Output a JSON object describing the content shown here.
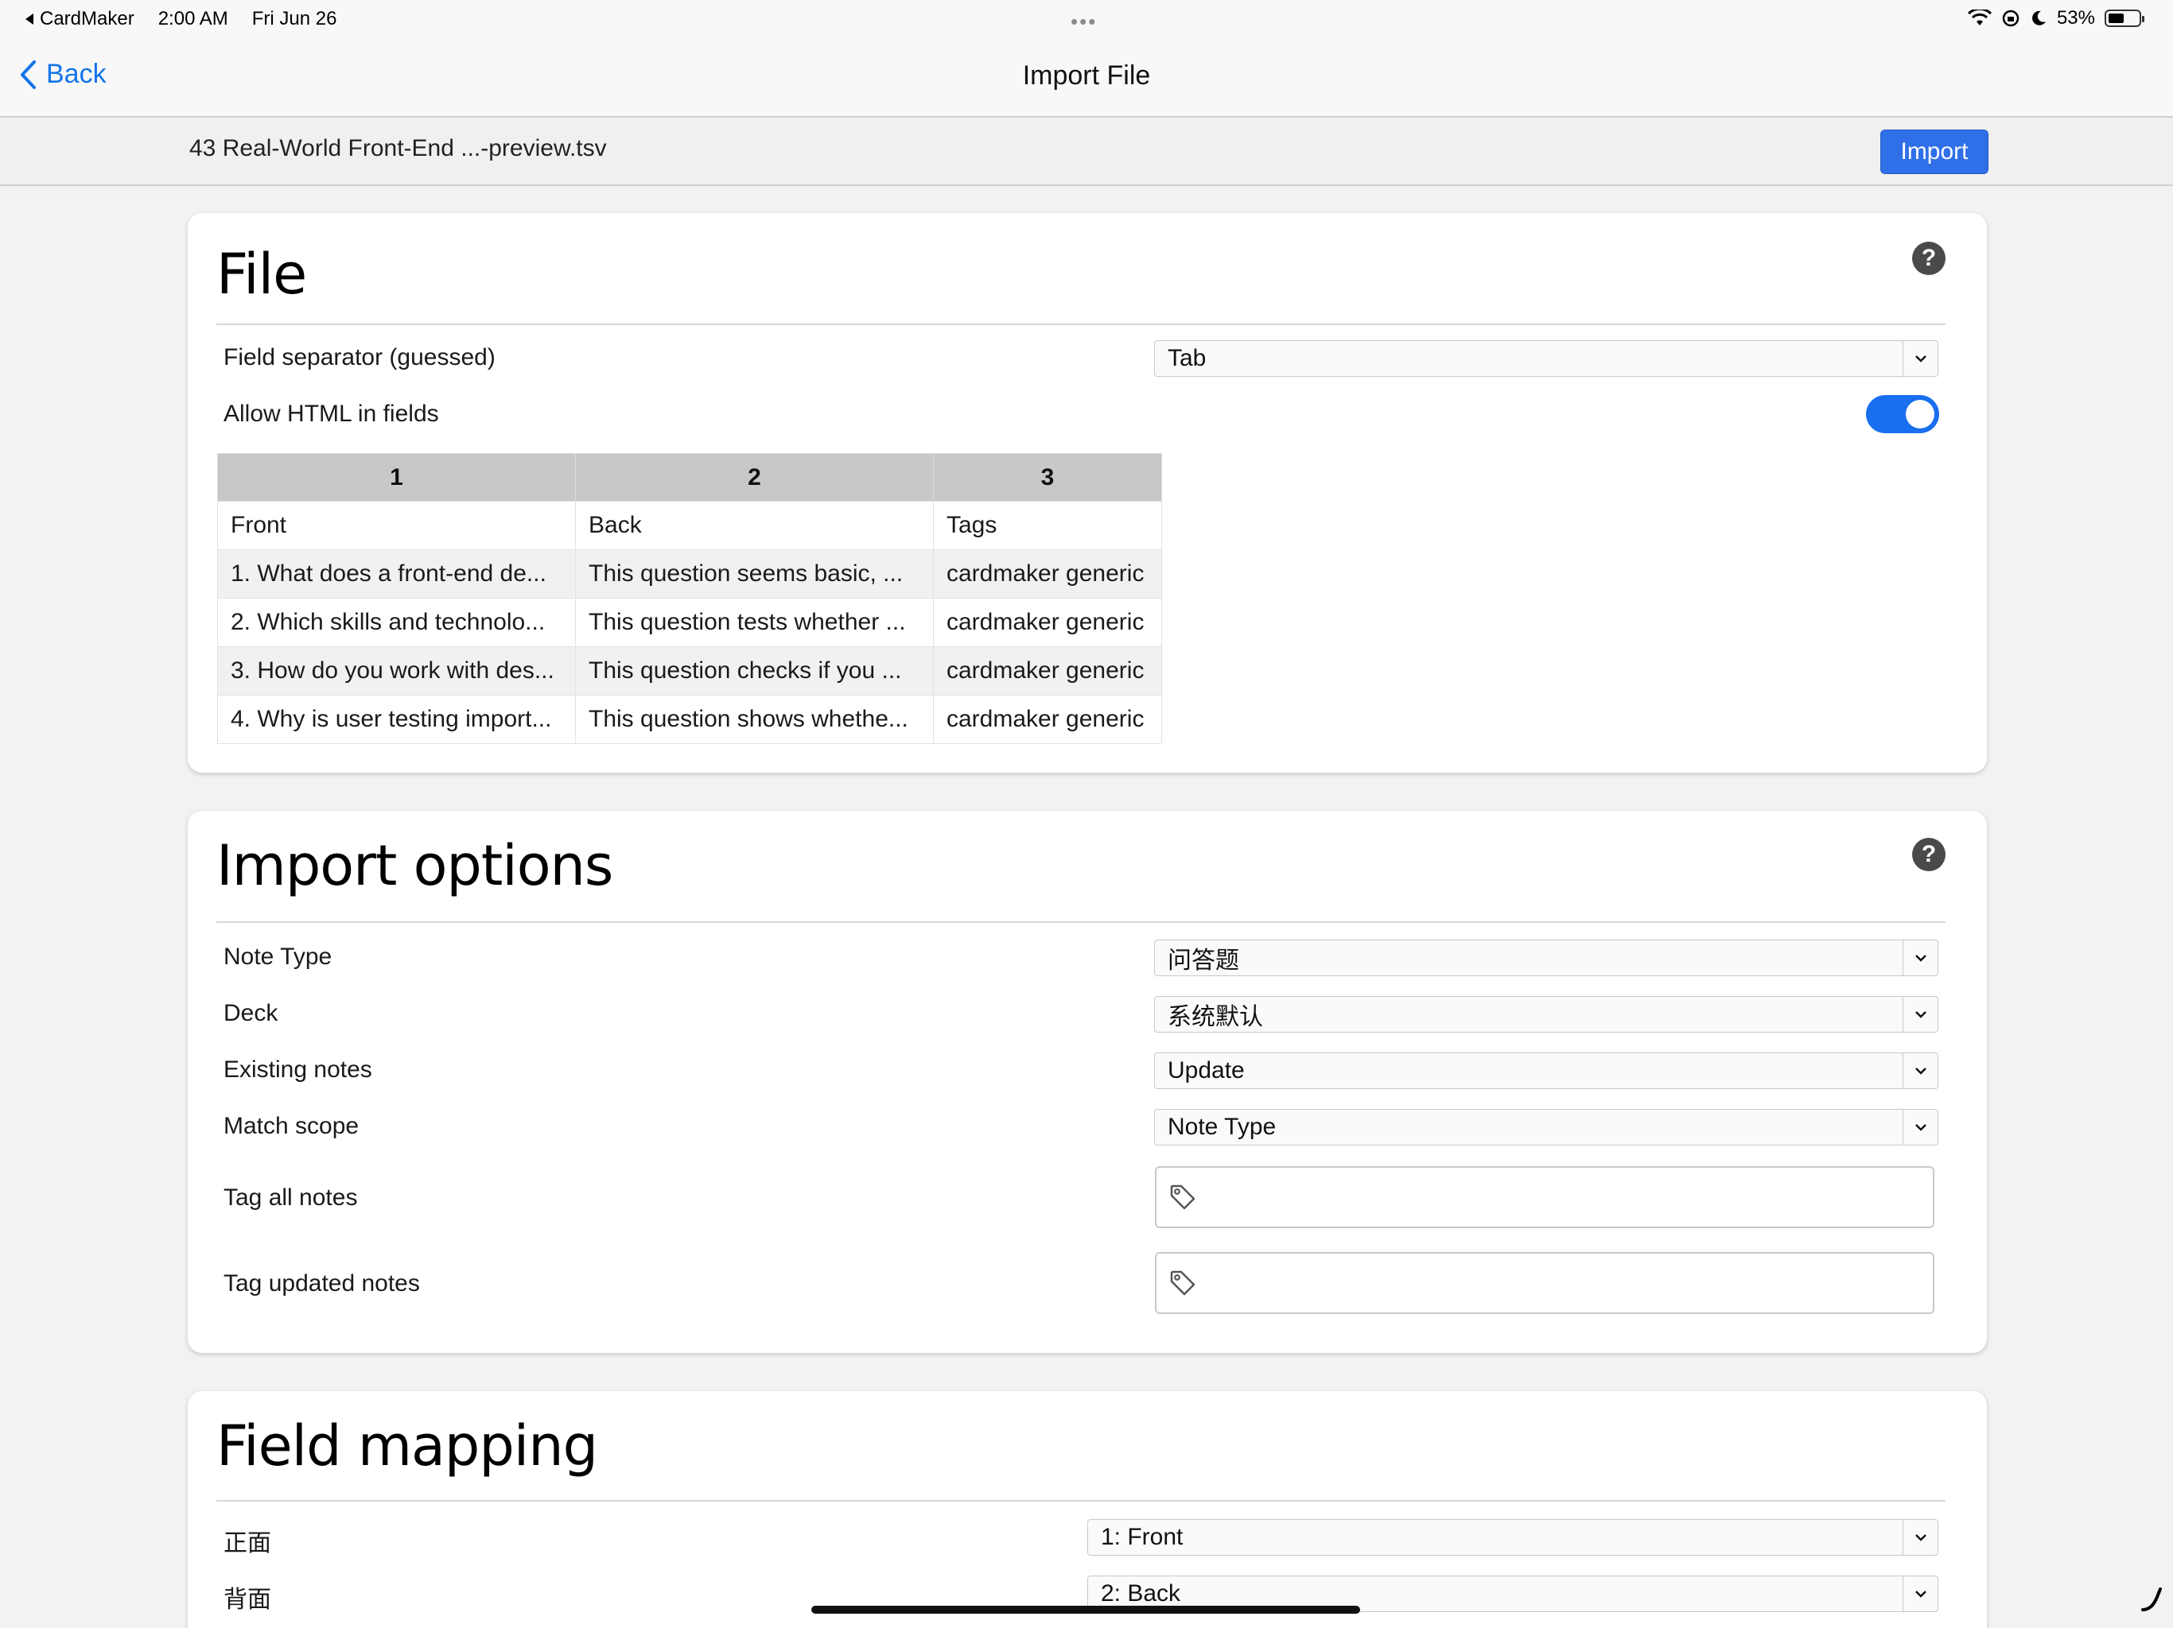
{
  "status_bar": {
    "app_back": "CardMaker",
    "time": "2:00 AM",
    "date": "Fri Jun 26",
    "battery": "53%",
    "battery_level": 0.53
  },
  "nav": {
    "back_label": "Back",
    "title": "Import File"
  },
  "file_bar": {
    "filename": "43 Real-World Front-End ...-preview.tsv",
    "import_label": "Import"
  },
  "file_section": {
    "title": "File",
    "help": "?",
    "separator_label": "Field separator (guessed)",
    "separator_value": "Tab",
    "allow_html_label": "Allow HTML in fields",
    "allow_html_on": true,
    "table": {
      "headers": [
        "1",
        "2",
        "3"
      ],
      "rows": [
        [
          "Front",
          "Back",
          "Tags"
        ],
        [
          "1. What does a front-end de...",
          "This question seems basic, ...",
          "cardmaker generic"
        ],
        [
          "2. Which skills and technolo...",
          "This question tests whether ...",
          "cardmaker generic"
        ],
        [
          "3. How do you work with des...",
          "This question checks if you ...",
          "cardmaker generic"
        ],
        [
          "4. Why is user testing import...",
          "This question shows whethe...",
          "cardmaker generic"
        ]
      ]
    }
  },
  "import_options": {
    "title": "Import options",
    "help": "?",
    "note_type_label": "Note Type",
    "note_type_value": "问答题",
    "deck_label": "Deck",
    "deck_value": "系统默认",
    "existing_label": "Existing notes",
    "existing_value": "Update",
    "match_label": "Match scope",
    "match_value": "Note Type",
    "tag_all_label": "Tag all notes",
    "tag_updated_label": "Tag updated notes"
  },
  "field_mapping": {
    "title": "Field mapping",
    "front_label": "正面",
    "front_value": "1: Front",
    "back_label": "背面",
    "back_value": "2: Back"
  },
  "colors": {
    "accent": "#1474e8",
    "button": "#2f6fe8",
    "toggle": "#1a6ef0"
  }
}
